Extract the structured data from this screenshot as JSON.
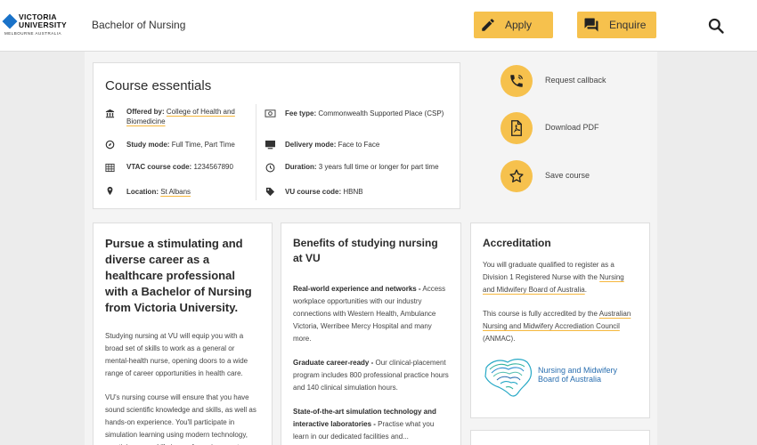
{
  "header": {
    "logo_line1": "VICTORIA",
    "logo_line2": "UNIVERSITY",
    "logo_line3": "MELBOURNE AUSTRALIA",
    "course_name": "Bachelor of Nursing",
    "apply_label": "Apply",
    "enquire_label": "Enquire",
    "accent_color": "#f6c14d"
  },
  "essentials": {
    "title": "Course essentials",
    "offered_by_label": "Offered by:",
    "offered_by_value": "College of Health and Biomedicine",
    "study_mode_label": "Study mode:",
    "study_mode_value": "Full Time, Part Time",
    "vtac_label": "VTAC course code:",
    "vtac_value": "1234567890",
    "location_label": "Location:",
    "location_value": "St Albans",
    "fee_type_label": "Fee type:",
    "fee_type_value": "Commonwealth Supported Place (CSP)",
    "delivery_label": "Delivery mode:",
    "delivery_value": "Face to Face",
    "duration_label": "Duration:",
    "duration_value": "3 years full time or longer for part time",
    "vu_code_label": "VU course code:",
    "vu_code_value": "HBNB"
  },
  "actions": {
    "callback_label": "Request callback",
    "pdf_label": "Download PDF",
    "save_label": "Save course"
  },
  "intro": {
    "heading": "Pursue a stimulating and diverse career as a healthcare professional with a Bachelor of Nursing from Victoria University.",
    "para1": "Studying nursing at VU will equip you with a broad set of skills to work as a general or mental-health nurse, opening doors to a wide range of career opportunities in health care.",
    "para2": "VU's nursing course will ensure that you have sound scientific knowledge and skills, as well as hands-on experience. You'll participate in simulation learning using modern technology, practising your skills in a safe environment."
  },
  "benefits": {
    "heading": "Benefits of studying nursing at VU",
    "item1_title": "Real-world experience and networks -",
    "item1_text": " Access workplace opportunities with our industry connections with Western Health, Ambulance Victoria, Werribee Mercy Hospital and many more.",
    "item2_title": "Graduate career-ready -",
    "item2_text": " Our clinical-placement program includes 800 professional practice hours and 140 clinical simulation hours.",
    "item3_title": "State-of-the-art simulation technology and interactive laboratories -",
    "item3_text": " Practise what you learn in our dedicated facilities and..."
  },
  "accreditation": {
    "heading": "Accreditation",
    "para1_pre": "You will graduate qualified to register as a Division 1 Registered Nurse with the ",
    "para1_link": "Nursing and Midwifery Board of Australia",
    "para1_post": ".",
    "para2_pre": "This course is fully accredited by the ",
    "para2_link": "Australian Nursing and Midwifery Accrediation Council",
    "para2_post": " (ANMAC).",
    "logo_line1": "Nursing and Midwifery",
    "logo_line2": "Board of Australia"
  }
}
